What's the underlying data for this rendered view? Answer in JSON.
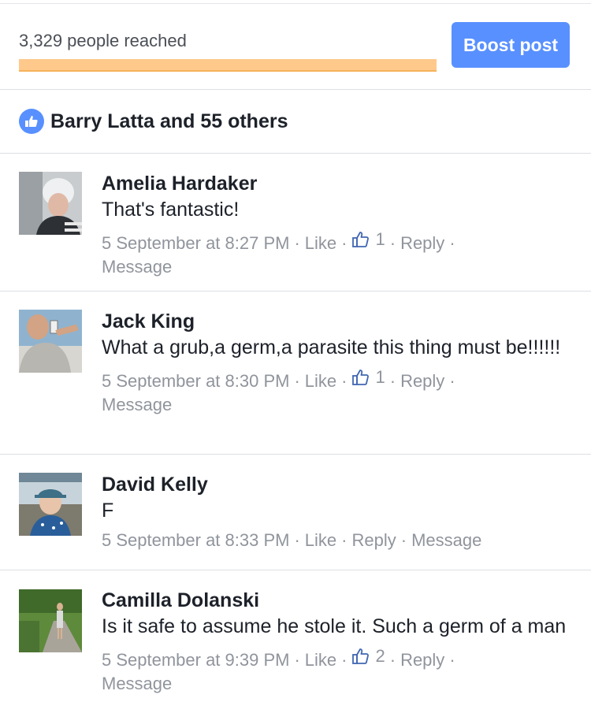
{
  "reach": {
    "text": "3,329 people reached",
    "progress": 1.0,
    "boost_label": "Boost post"
  },
  "likes": {
    "text": "Barry Latta and 55 others"
  },
  "meta_labels": {
    "like": "Like",
    "reply": "Reply",
    "message": "Message",
    "separator": "·"
  },
  "comments": [
    {
      "name": "Amelia Hardaker",
      "text": "That's fantastic!",
      "time": "5 September at 8:27 PM",
      "likes": "1"
    },
    {
      "name": "Jack King",
      "text": "What a grub,a germ,a parasite this thing must be!!!!!!",
      "time": "5 September at 8:30 PM",
      "likes": "1"
    },
    {
      "name": "David Kelly",
      "text": "F",
      "time": "5 September at 8:33 PM",
      "likes": ""
    },
    {
      "name": "Camilla Dolanski",
      "text": "Is it safe to assume he stole it. Such a germ of a man",
      "time": "5 September at 9:39 PM",
      "likes": "2"
    }
  ],
  "colors": {
    "accent": "#5890ff",
    "reach_fill": "#ffc98b",
    "meta": "#90949c"
  }
}
